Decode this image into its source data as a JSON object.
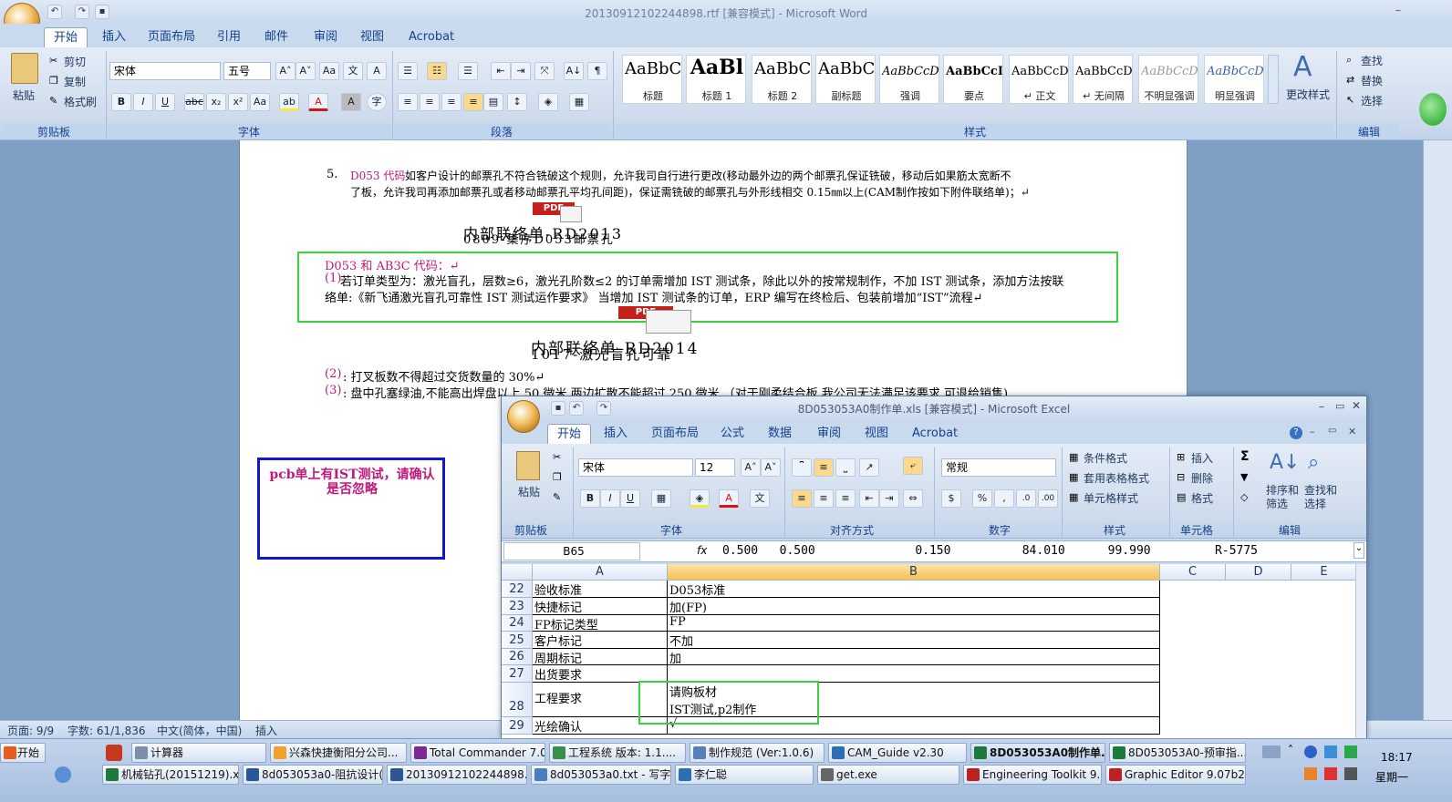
{
  "word": {
    "title": "20130912102244898.rtf [兼容模式] - Microsoft Word",
    "tabs": [
      "开始",
      "插入",
      "页面布局",
      "引用",
      "邮件",
      "审阅",
      "视图",
      "Acrobat"
    ],
    "clipboard": {
      "paste": "粘贴",
      "cut": "剪切",
      "copy": "复制",
      "format_painter": "格式刷",
      "label": "剪贴板"
    },
    "font": {
      "name": "宋体",
      "size": "五号",
      "label": "字体"
    },
    "paragraph_label": "段落",
    "styles": {
      "label": "样式",
      "items": [
        {
          "sample": "AaBbC",
          "name": "标题"
        },
        {
          "sample": "AaBl",
          "name": "标题 1"
        },
        {
          "sample": "AaBbC",
          "name": "标题 2"
        },
        {
          "sample": "AaBbC",
          "name": "副标题"
        },
        {
          "sample": "AaBbCcD",
          "name": "强调"
        },
        {
          "sample": "AaBbCcD",
          "name": "要点"
        },
        {
          "sample": "AaBbCcD",
          "name": "↵ 正文"
        },
        {
          "sample": "AaBbCcD",
          "name": "↵ 无间隔"
        },
        {
          "sample": "AaBbCcD",
          "name": "不明显强调"
        },
        {
          "sample": "AaBbCcD",
          "name": "明显强调"
        }
      ],
      "change": "更改样式"
    },
    "editing": {
      "find": "查找",
      "replace": "替换",
      "select": "选择",
      "label": "编辑"
    },
    "doc": {
      "item5_num": "5.",
      "item5_code": "D053 代码",
      "item5_line1": "如客户设计的邮票孔不符合铣破这个规则，允许我司自行进行更改(移动最外边的两个邮票孔保证铣破，移动后如果筋太宽断不",
      "item5_line2": "了板，允许我司再添加邮票孔或者移动邮票孔平均孔间距)，保证需铣破的邮票孔与外形线相交 0.15㎜以上(CAM制作按如下附件联络单)；↵",
      "pdf1_caption_a": "内部联络单-RD2013",
      "pdf1_caption_b": "0809-集序D053邮票孔",
      "d053_title": "D053 和 AB3C 代码：↵",
      "d053_p1_num": "(1)",
      "d053_p1_line1": "若订单类型为：激光盲孔，层数≥6，激光孔阶数≤2 的订单需增加 IST 测试条，除此以外的按常规制作，不加 IST 测试条，添加方法按联",
      "d053_p1_line2": "络单:《新飞通激光盲孔可靠性 IST 测试运作要求》 当增加 IST 测试条的订单，ERP 编写在终检后、包装前增加“IST”流程↵",
      "pdf2_caption_a": "内部联络单-RD2014",
      "pdf2_caption_b": "1017-激光盲孔可靠",
      "p2_num": "(2)",
      "p2_text": ": 打叉板数不得超过交货数量的 30%↵",
      "p3_num": "(3)",
      "p3_text": ": 盘中孔塞绿油,不能高出焊盘以上 50 微米,两边扩散不能超过 250 微米.（对于刚柔结合板,我公司无法满足该要求,可退给销售)",
      "pdf_label": "PDF",
      "note_box": "pcb单上有IST测试，请确认是否忽略"
    },
    "status": {
      "page": "页面: 9/9",
      "words": "字数: 61/1,836",
      "lang": "中文(简体，中国)",
      "mode": "插入"
    }
  },
  "excel": {
    "title": "8D053053A0制作单.xls [兼容模式] - Microsoft Excel",
    "tabs": [
      "开始",
      "插入",
      "页面布局",
      "公式",
      "数据",
      "审阅",
      "视图",
      "Acrobat"
    ],
    "clipboard_label": "剪贴板",
    "paste": "粘贴",
    "font": {
      "name": "宋体",
      "size": "12",
      "label": "字体"
    },
    "align_label": "对齐方式",
    "number": {
      "format": "常规",
      "label": "数字"
    },
    "styles": {
      "cond": "条件格式",
      "table": "套用表格格式",
      "cell": "单元格样式",
      "label": "样式"
    },
    "cells_grp": {
      "insert": "插入",
      "delete": "删除",
      "format": "格式",
      "label": "单元格"
    },
    "editing": {
      "sort": "排序和筛选",
      "find": "查找和选择",
      "label": "编辑"
    },
    "name_box": "B65",
    "fx": "fx",
    "formula": "0.500   0.500              0.150          84.010      99.990         R-5775",
    "columns": [
      "A",
      "B",
      "C",
      "D",
      "E"
    ],
    "rows": [
      {
        "num": "22",
        "a": "验收标准",
        "b": "D053标准"
      },
      {
        "num": "23",
        "a": "快捷标记",
        "b": "加(FP)"
      },
      {
        "num": "24",
        "a": "FP标记类型",
        "b": "FP"
      },
      {
        "num": "25",
        "a": "客户标记",
        "b": "不加"
      },
      {
        "num": "26",
        "a": "周期标记",
        "b": "加"
      },
      {
        "num": "27",
        "a": "出货要求",
        "b": ""
      },
      {
        "num": "28",
        "a": "工程要求",
        "b": "请购板材",
        "b2": "IST测试,p2制作"
      },
      {
        "num": "29",
        "a": "光绘确认",
        "b": "√"
      }
    ]
  },
  "taskbar": {
    "start": "开始",
    "row1": [
      "计算器",
      "兴森快捷衡阳分公司...",
      "Total Commander 7.0 p...",
      "工程系统  版本: 1.1....",
      "制作规范 (Ver:1.0.6)",
      "CAM_Guide v2.30",
      "8D053053A0制作单....",
      "8D053053A0-预审指..."
    ],
    "row2": [
      "机械钻孔(20151219).xl...",
      "8d053053a0-阻抗设计(...",
      "20130912102244898.rtf...",
      "8d053053a0.txt - 写字板",
      "李仁聪",
      "get.exe",
      "Engineering Toolkit 9.07...",
      "Graphic Editor 9.07b2 (0..."
    ],
    "clock": "18:17",
    "weekday": "星期一"
  }
}
